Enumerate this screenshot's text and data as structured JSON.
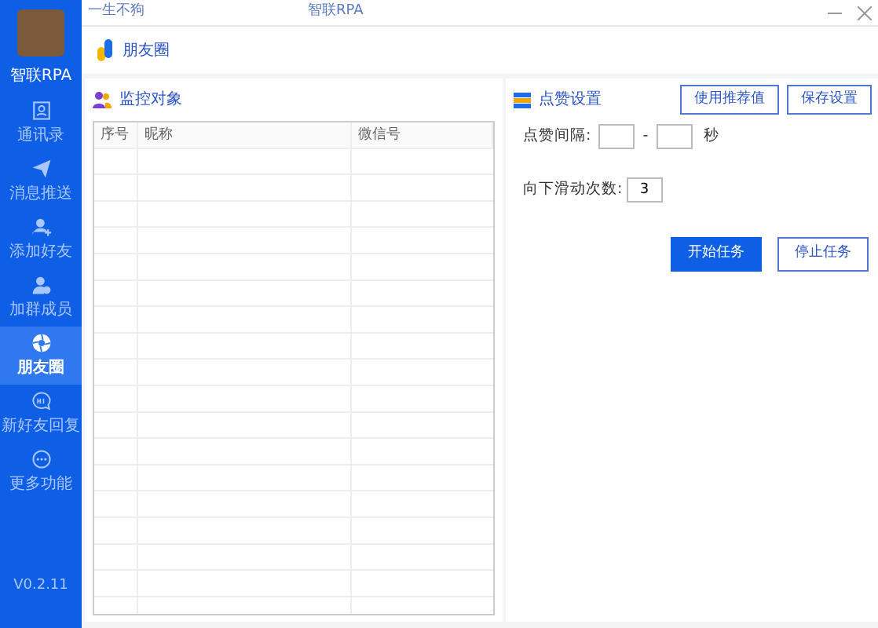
{
  "window": {
    "title": "智联RPA",
    "user": "一生不狗"
  },
  "sidebar": {
    "app_name": "智联RPA",
    "version": "V0.2.11",
    "items": [
      {
        "label": "通讯录",
        "kind": "contacts",
        "selected": false
      },
      {
        "label": "消息推送",
        "kind": "send",
        "selected": false
      },
      {
        "label": "添加好友",
        "kind": "add-user",
        "selected": false
      },
      {
        "label": "加群成员",
        "kind": "group",
        "selected": false
      },
      {
        "label": "朋友圈",
        "kind": "aperture",
        "selected": true
      },
      {
        "label": "新好友回复",
        "kind": "chat",
        "selected": false
      },
      {
        "label": "更多功能",
        "kind": "more",
        "selected": false
      }
    ]
  },
  "page_title": "朋友圈",
  "monitor": {
    "title": "监控对象",
    "table": {
      "columns": [
        "序号",
        "昵称",
        "微信号"
      ]
    }
  },
  "settings": {
    "title": "点赞设置",
    "top_buttons": [
      "使用推荐值",
      "保存设置"
    ],
    "interval": {
      "label": "点赞间隔:",
      "separator": "-",
      "unit": "秒"
    },
    "scroll": {
      "label": "向下滑动次数:",
      "value": "3"
    },
    "buttons": [
      {
        "label": "开始任务",
        "primary": true
      },
      {
        "label": "停止任务",
        "primary": false
      }
    ]
  }
}
